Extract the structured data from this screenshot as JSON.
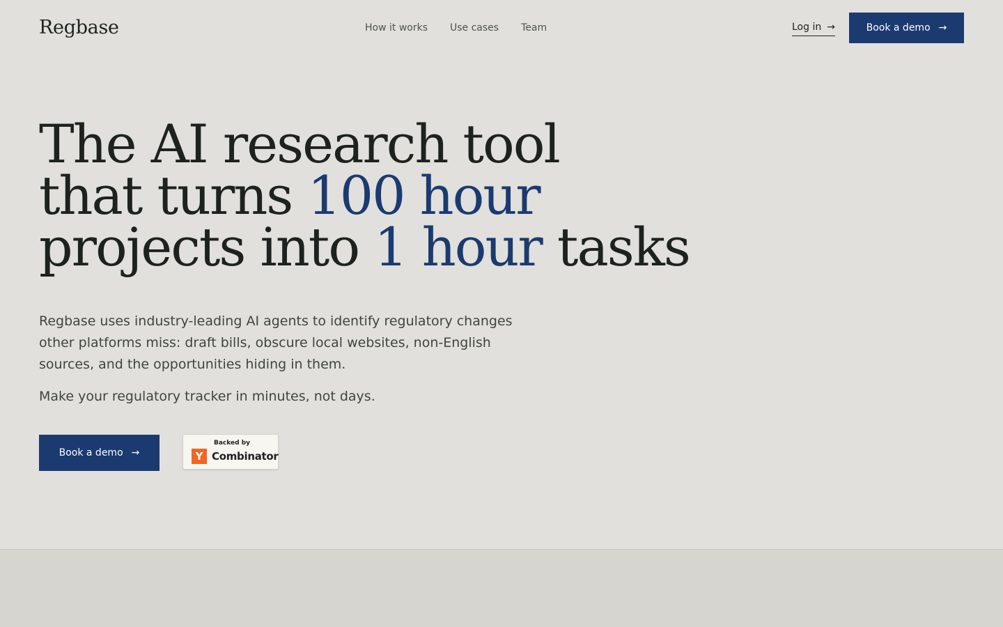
{
  "header": {
    "logo": "Regbase",
    "nav": [
      {
        "label": "How it works"
      },
      {
        "label": "Use cases"
      },
      {
        "label": "Team"
      }
    ],
    "login_label": "Log in",
    "demo_label": "Book a demo",
    "arrow": "→"
  },
  "hero": {
    "title": {
      "line1": "The AI research tool",
      "line2_prefix": "that turns ",
      "line2_accent": "100 hour",
      "line3_prefix": "projects into ",
      "line3_accent": "1 hour",
      "line3_suffix": " tasks"
    },
    "description": "Regbase uses industry-leading AI agents to identify regulatory changes other platforms miss: draft bills, obscure local websites, non-English sources, and the opportunities hiding in them.",
    "tagline": "Make your regulatory tracker in minutes, not days.",
    "cta_label": "Book a demo",
    "cta_arrow": "→",
    "badge": {
      "backed_by": "Backed by",
      "logo_letter": "Y",
      "name": "Combinator"
    }
  },
  "colors": {
    "background": "#e1e0dc",
    "accent": "#1b3a70",
    "yc_orange": "#f26522"
  }
}
